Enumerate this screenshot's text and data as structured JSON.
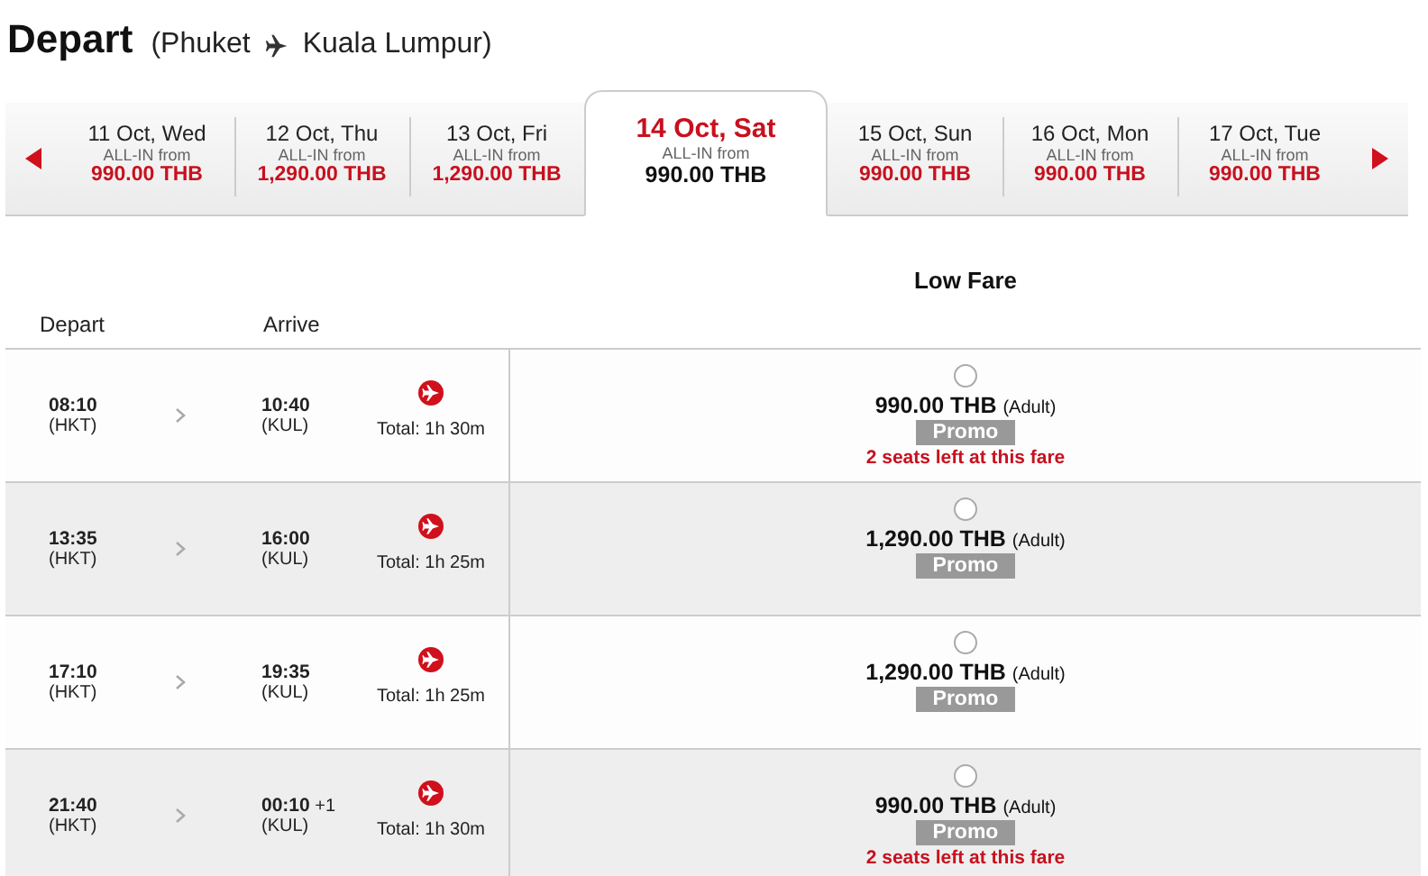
{
  "heading": {
    "title": "Depart",
    "origin": "(Phuket",
    "destination": "Kuala Lumpur)"
  },
  "dates": [
    {
      "date": "11 Oct, Wed",
      "note": "ALL-IN from",
      "price": "990.00 THB",
      "selected": false
    },
    {
      "date": "12 Oct, Thu",
      "note": "ALL-IN from",
      "price": "1,290.00 THB",
      "selected": false
    },
    {
      "date": "13 Oct, Fri",
      "note": "ALL-IN from",
      "price": "1,290.00 THB",
      "selected": false
    },
    {
      "date": "14 Oct, Sat",
      "note": "ALL-IN from",
      "price": "990.00 THB",
      "selected": true
    },
    {
      "date": "15 Oct, Sun",
      "note": "ALL-IN from",
      "price": "990.00 THB",
      "selected": false
    },
    {
      "date": "16 Oct, Mon",
      "note": "ALL-IN from",
      "price": "990.00 THB",
      "selected": false
    },
    {
      "date": "17 Oct, Tue",
      "note": "ALL-IN from",
      "price": "990.00 THB",
      "selected": false
    }
  ],
  "table": {
    "fare_heading": "Low Fare",
    "columns": [
      "Depart",
      "Arrive"
    ],
    "rows": [
      {
        "depart": "08:10",
        "depart_code": "(HKT)",
        "arrive": "10:40",
        "arrive_code": "(KUL)",
        "total": "Total: 1h 30m",
        "price": "990.00 THB",
        "passenger": "(Adult)",
        "badge": "Promo",
        "seats": "2 seats left at this fare",
        "selected": false
      },
      {
        "depart": "13:35",
        "depart_code": "(HKT)",
        "arrive": "16:00",
        "arrive_code": "(KUL)",
        "total": "Total: 1h 25m",
        "price": "1,290.00 THB",
        "passenger": "(Adult)",
        "badge": "Promo",
        "selected": false
      },
      {
        "depart": "17:10",
        "depart_code": "(HKT)",
        "arrive": "19:35",
        "arrive_code": "(KUL)",
        "total": "Total: 1h 25m",
        "price": "1,290.00 THB",
        "passenger": "(Adult)",
        "badge": "Promo",
        "selected": false
      },
      {
        "depart": "21:40",
        "depart_code": "(HKT)",
        "arrive": "00:10",
        "arrive_next_day": "+1",
        "arrive_code": "(KUL)",
        "total": "Total: 1h 30m",
        "price": "990.00 THB",
        "passenger": "(Adult)",
        "badge": "Promo",
        "seats": "2 seats left at this fare",
        "selected": false
      }
    ]
  }
}
